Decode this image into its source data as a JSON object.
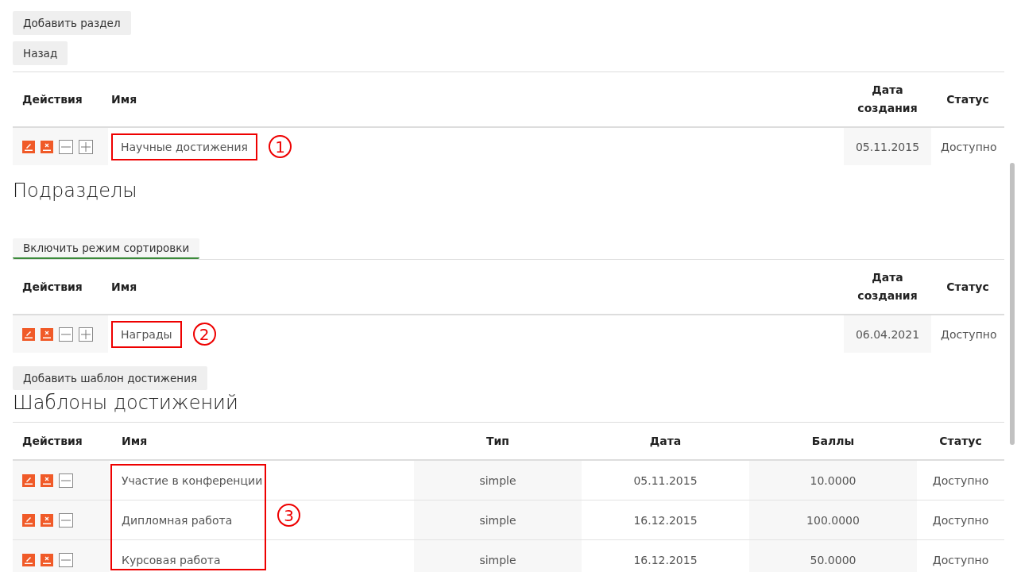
{
  "top_buttons": [
    "Добавить раздел",
    "Назад"
  ],
  "section_table": {
    "columns": [
      "Действия",
      "Имя",
      "Дата создания",
      "Статус"
    ],
    "rows": [
      {
        "name": "Научные достижения",
        "date": "05.11.2015",
        "status": "Доступно",
        "actions": [
          {
            "kind": "edit"
          },
          {
            "kind": "delete"
          },
          {
            "kind": "collapse"
          },
          {
            "kind": "expand"
          }
        ]
      }
    ],
    "annotation": "1"
  },
  "subsections": {
    "title": "Подразделы",
    "sort_button": "Включить режим сортировки",
    "columns": [
      "Действия",
      "Имя",
      "Дата создания",
      "Статус"
    ],
    "rows": [
      {
        "name": "Награды",
        "date": "06.04.2021",
        "status": "Доступно",
        "actions": [
          {
            "kind": "edit"
          },
          {
            "kind": "delete"
          },
          {
            "kind": "collapse"
          },
          {
            "kind": "expand"
          }
        ]
      }
    ],
    "annotation": "2"
  },
  "templates": {
    "add_button": "Добавить шаблон достижения",
    "title": "Шаблоны достижений",
    "columns": [
      "Действия",
      "Имя",
      "Тип",
      "Дата",
      "Баллы",
      "Статус"
    ],
    "rows": [
      {
        "name": "Участие в конференции",
        "type": "simple",
        "date": "05.11.2015",
        "points": "10.0000",
        "status": "Доступно",
        "actions": [
          {
            "kind": "edit"
          },
          {
            "kind": "delete"
          },
          {
            "kind": "collapse"
          }
        ]
      },
      {
        "name": "Дипломная работа",
        "type": "simple",
        "date": "16.12.2015",
        "points": "100.0000",
        "status": "Доступно",
        "actions": [
          {
            "kind": "edit"
          },
          {
            "kind": "delete"
          },
          {
            "kind": "collapse"
          }
        ]
      },
      {
        "name": "Курсовая работа",
        "type": "simple",
        "date": "16.12.2015",
        "points": "50.0000",
        "status": "Доступно",
        "actions": [
          {
            "kind": "edit"
          },
          {
            "kind": "delete"
          },
          {
            "kind": "collapse"
          }
        ]
      }
    ],
    "annotation": "3"
  }
}
